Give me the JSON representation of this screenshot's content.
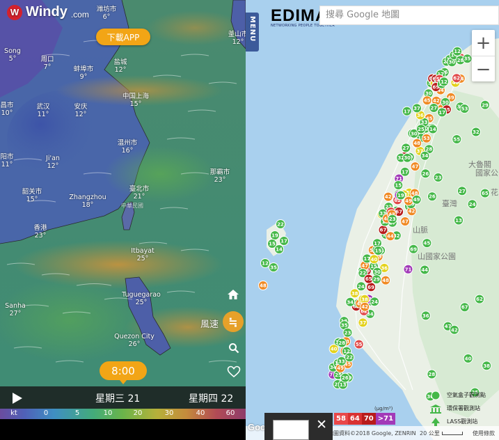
{
  "windy": {
    "logo": "Windy",
    "logo_domain": ".com",
    "app_button": "下載APP",
    "cities": [
      {
        "name": "潍坊市",
        "temp": "6°"
      },
      {
        "name": "釜山市",
        "temp": "12°"
      },
      {
        "name": "Song",
        "temp": "5°"
      },
      {
        "name": "周口",
        "temp": "7°"
      },
      {
        "name": "蚌埠市",
        "temp": "9°"
      },
      {
        "name": "盐城",
        "temp": "12°"
      },
      {
        "name": "中国上海",
        "temp": "15°"
      },
      {
        "name": "昌市",
        "temp": "10°"
      },
      {
        "name": "武汉",
        "temp": "11°"
      },
      {
        "name": "安庆",
        "temp": "12°"
      },
      {
        "name": "温州市",
        "temp": "16°"
      },
      {
        "name": "阳市",
        "temp": "11°"
      },
      {
        "name": "Ji'an",
        "temp": "12°"
      },
      {
        "name": "那霸市",
        "temp": "23°"
      },
      {
        "name": "韶关市",
        "temp": "15°"
      },
      {
        "name": "Zhangzhou",
        "temp": "18°"
      },
      {
        "name": "臺北市",
        "temp": "21°"
      },
      {
        "name": "香港",
        "temp": "23°"
      },
      {
        "name": "Itbayat",
        "temp": "25°"
      },
      {
        "name": "Tuguegarao",
        "temp": "25°"
      },
      {
        "name": "Sanha",
        "temp": "27°"
      },
      {
        "name": "Quezon City",
        "temp": "26°"
      }
    ],
    "island_label": "中華民國",
    "wind_label": "風速",
    "time_bubble": "8:00",
    "day1": "星期三 21",
    "day2": "星期四 22",
    "scale_unit": "kt",
    "scale": [
      "0",
      "5",
      "10",
      "20",
      "30",
      "40",
      "60"
    ]
  },
  "gmap": {
    "menu_label": "MENU",
    "brand": "EDIMAX",
    "brand_tagline": "NETWORKING PEOPLE TOGETHER",
    "search_placeholder": "搜尋 Google 地圖",
    "zoom_in": "+",
    "zoom_out": "−",
    "labels": [
      "大魯閣",
      "國家公",
      "臺灣",
      "山脈",
      "山國家公園",
      "花"
    ],
    "legend": [
      {
        "label": "空氣盒子觀測點",
        "icon": "circle-marker-icon",
        "color": "#45b849"
      },
      {
        "label": "環保署觀測站",
        "icon": "building-marker-icon",
        "color": "#45b849"
      },
      {
        "label": "LASS觀測站",
        "icon": "tree-marker-icon",
        "color": "#45b849"
      }
    ],
    "aqi_unit": "(μg/m³)",
    "aqi_scale": [
      {
        "value": "58",
        "color": "#e8484a"
      },
      {
        "value": "64",
        "color": "#d93232"
      },
      {
        "value": "70",
        "color": "#b81c1c"
      },
      {
        "value": ">71",
        "color": "#a23ab8"
      }
    ],
    "google_logo": "Google",
    "footer_copyright": "地圖資料©2018 Google, ZENRIN",
    "footer_scale": "20 公里",
    "footer_terms": "使用條款",
    "markers_visible_values": [
      "32",
      "37",
      "40",
      "33",
      "30",
      "30",
      "17",
      "44",
      "55",
      "45",
      "69",
      "71",
      "67",
      "65",
      "62",
      "53",
      "49",
      "47",
      "42",
      "38",
      "34",
      "27",
      "24",
      "23",
      "28",
      "29",
      "26",
      "25",
      "22",
      "19",
      "17",
      "15",
      "14",
      "12",
      "35",
      "48",
      "36",
      "13"
    ]
  },
  "colors": {
    "windy_orange": "#f2a516",
    "aqi_green": "#45b849",
    "aqi_yellow": "#e3d21b",
    "aqi_orange": "#f08a24",
    "aqi_red": "#e04848",
    "aqi_purple": "#a23ab8"
  }
}
